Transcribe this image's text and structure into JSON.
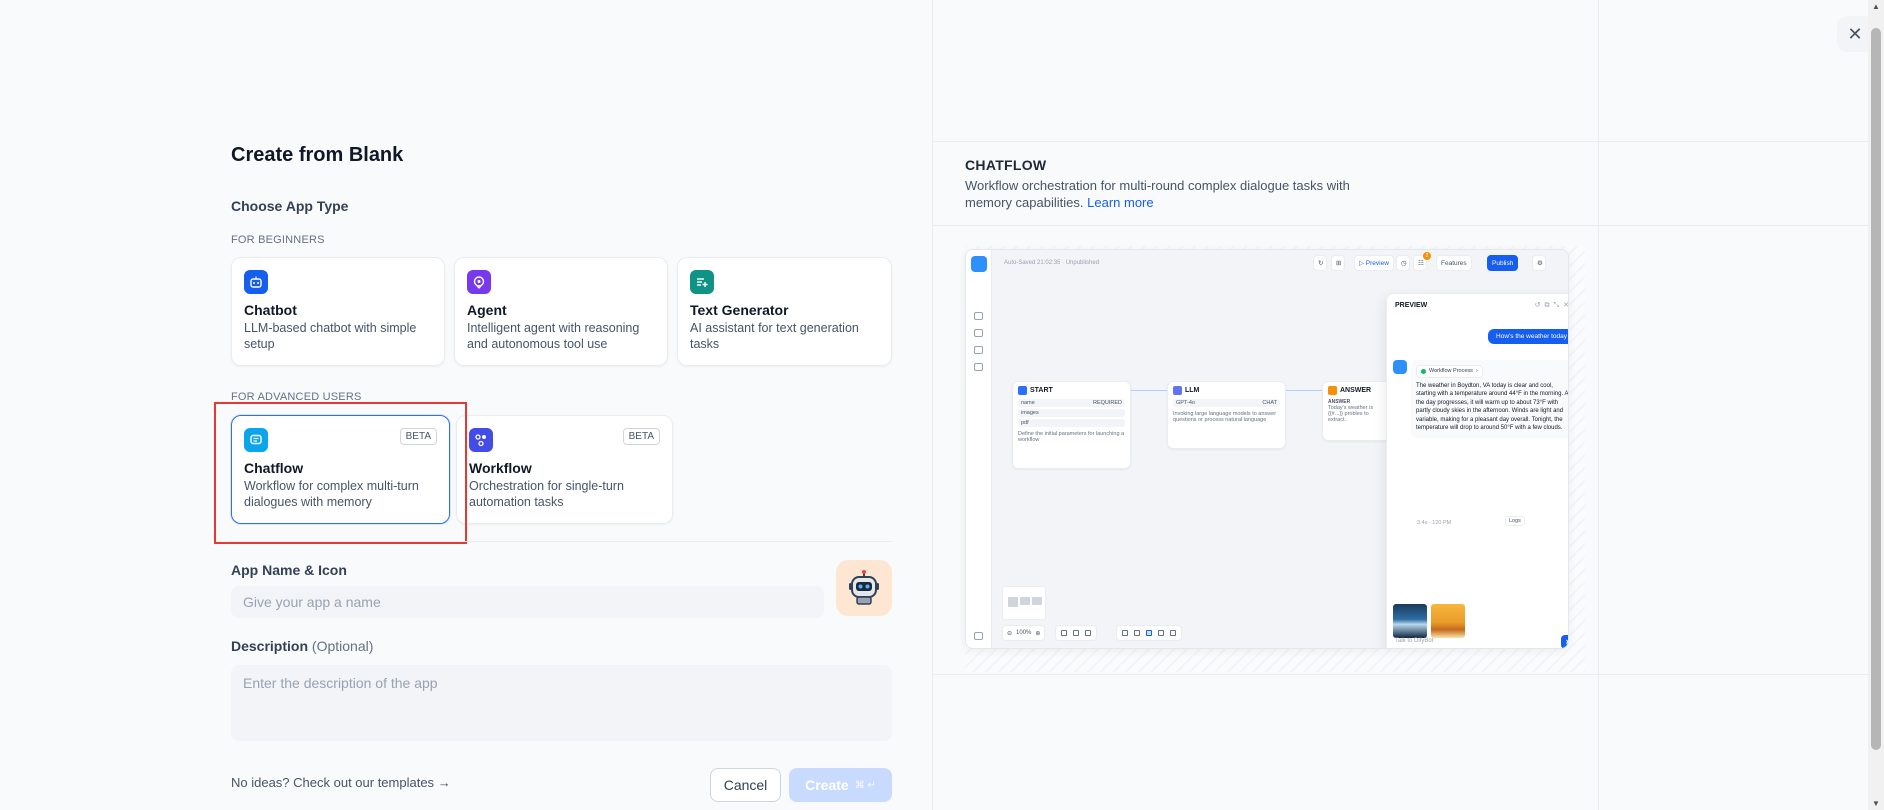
{
  "create": {
    "title": "Create from Blank",
    "choose_type": "Choose App Type",
    "group_beginners": "FOR BEGINNERS",
    "group_advanced": "FOR ADVANCED USERS",
    "beginner_cards": [
      {
        "title": "Chatbot",
        "desc": "LLM-based chatbot with simple setup",
        "icon": "chatbot-icon"
      },
      {
        "title": "Agent",
        "desc": "Intelligent agent with reasoning and autonomous tool use",
        "icon": "agent-icon"
      },
      {
        "title": "Text Generator",
        "desc": "AI assistant for text generation tasks",
        "icon": "text-generator-icon"
      }
    ],
    "advanced_cards": [
      {
        "title": "Chatflow",
        "desc": "Workflow for complex multi-turn dialogues with memory",
        "badge": "BETA",
        "icon": "chatflow-icon"
      },
      {
        "title": "Workflow",
        "desc": "Orchestration for single-turn automation tasks",
        "badge": "BETA",
        "icon": "workflow-icon"
      }
    ],
    "selected": "Chatflow",
    "app_name_label": "App Name & Icon",
    "app_name_placeholder": "Give your app a name",
    "description_label": "Description",
    "description_optional": "(Optional)",
    "description_placeholder": "Enter the description of the app",
    "templates_link": "No ideas? Check out our templates",
    "cancel_label": "Cancel",
    "create_label": "Create",
    "create_shortcut": "⌘ ↵",
    "app_icon": "robot-avatar-icon",
    "colors": {
      "accent": "#2970ff",
      "selection_box": "#e53935",
      "chatbot": "#155eef",
      "agent": "#7839ee",
      "text_generator": "#0e9384",
      "chatflow": "#0ba5ec",
      "workflow": "#444ce7"
    }
  },
  "preview": {
    "title": "CHATFLOW",
    "desc": "Workflow orchestration for multi-round complex dialogue tasks with memory capabilities.",
    "learn_more": "Learn more",
    "mock": {
      "autosaved": "Auto-Saved 21:02:35 · Unpublished",
      "toolbar": {
        "preview": "▷ Preview",
        "features": "Features",
        "publish": "Publish",
        "badge": "2"
      },
      "nodes": {
        "start": {
          "title": "START",
          "vars": [
            {
              "name": "name",
              "tag": "REQUIRED"
            },
            {
              "name": "images",
              "tag": ""
            },
            {
              "name": "pdf",
              "tag": ""
            }
          ],
          "note": "Define the initial parameters for launching a workflow"
        },
        "llm": {
          "title": "LLM",
          "model": "GPT-4o",
          "model_tag": "CHAT",
          "note": "Invoking large language models to answer questions or process natural language"
        },
        "answer": {
          "title": "ANSWER",
          "label": "ANSWER",
          "text": "Today's weather is {{#...}} probles to extract."
        }
      },
      "chat": {
        "title": "PREVIEW",
        "user_message": "How's the weather today",
        "process_label": "Workflow Process",
        "bot_message": "The weather in Boydton, VA today is clear and cool, starting with a temperature around 44°F in the morning. As the day progresses, it will warm up to about 73°F with partly cloudy skies in the afternoon. Winds are light and variable, making for a pleasant day overall. Tonight, the temperature will drop to around 50°F with a few clouds.",
        "meta": "3.4s · 120 PM",
        "logs": "Logs",
        "input_placeholder": "Talk to DifyBot"
      },
      "zoom": "100%"
    }
  },
  "close_label": "✕"
}
